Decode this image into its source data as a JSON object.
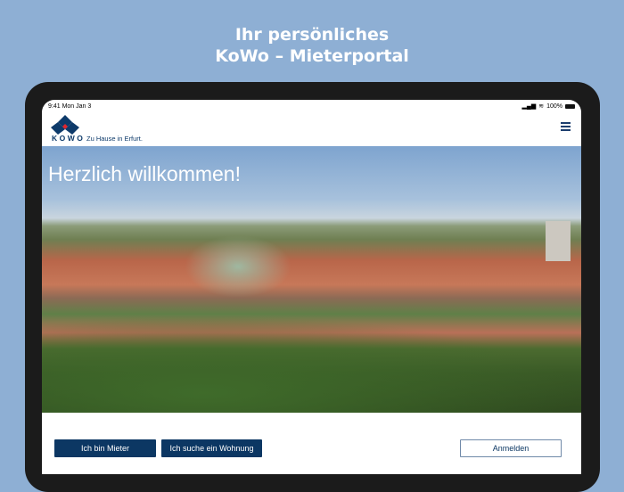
{
  "promo": {
    "line1": "Ihr persönliches",
    "line2": "KoWo – Mieterportal"
  },
  "status": {
    "time": "9:41",
    "date": "Mon Jan 3",
    "battery": "100%"
  },
  "header": {
    "brand": "KOWO",
    "tagline": "Zu Hause in Erfurt.",
    "menu_icon": "hamburger-icon"
  },
  "hero": {
    "title": "Herzlich willkommen!"
  },
  "actions": {
    "tenant": "Ich bin Mieter",
    "search": "Ich suche ein Wohnung",
    "login": "Anmelden"
  },
  "colors": {
    "brand": "#0c3763",
    "accent": "#e0252e",
    "background": "#8eafd4"
  }
}
